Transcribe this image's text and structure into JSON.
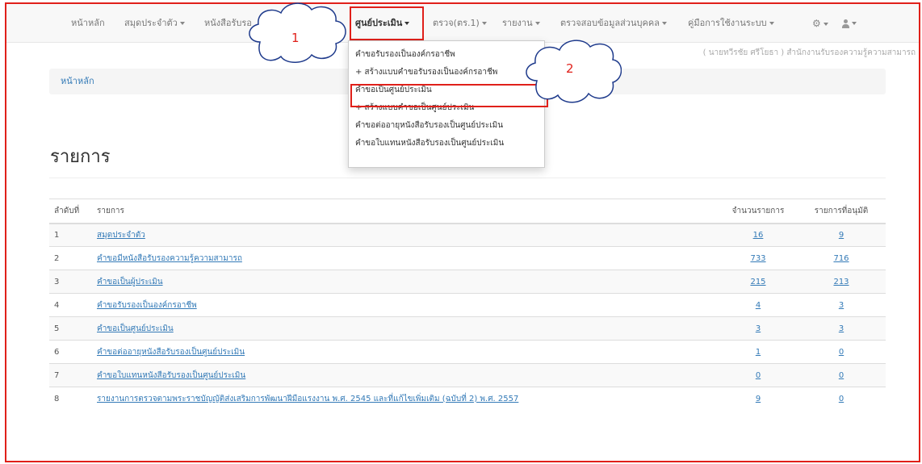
{
  "navbar": {
    "items": [
      {
        "label": "หน้าหลัก"
      },
      {
        "label": "สมุดประจำตัว"
      },
      {
        "label": "หนังสือรับรอ"
      },
      {
        "label": "ศูนย์ประเมิน"
      },
      {
        "label": "ตรวจ(ตร.1)"
      },
      {
        "label": "รายงาน"
      },
      {
        "label": "ตรวจสอบข้อมูลส่วนบุคคล"
      },
      {
        "label": "คู่มือการใช้งานระบบ"
      }
    ],
    "settings_icon": "gear-icon",
    "user_icon": "user-icon"
  },
  "user_info": "( นายทวีรชัย ศรีโยธา ) สำนักงานรับรองความรู้ความสามารถ",
  "breadcrumb": {
    "home": "หน้าหลัก"
  },
  "dropdown": {
    "items": [
      "คำขอรับรองเป็นองค์กรอาชีพ",
      "+ สร้างแบบคำขอรับรองเป็นองค์กรอาชีพ",
      "คำขอเป็นศูนย์ประเมิน",
      "+ สร้างแบบคำขอเป็นศูนย์ประเมิน",
      "คำขอต่ออายุหนังสือรับรองเป็นศูนย์ประเมิน",
      "คำขอใบแทนหนังสือรับรองเป็นศูนย์ประเมิน"
    ]
  },
  "annotations": {
    "step1": "1",
    "step2": "2",
    "color": "#e0201a"
  },
  "page_title": "รายการ",
  "table": {
    "headers": {
      "num": "ลำดับที่",
      "item": "รายการ",
      "count": "จำนวนรายการ",
      "approved": "รายการที่อนุมัติ"
    },
    "rows": [
      {
        "num": "1",
        "item": "สมุดประจำตัว",
        "count": "16",
        "approved": "9"
      },
      {
        "num": "2",
        "item": "คำขอมีหนังสือรับรองความรู้ความสามารถ",
        "count": "733",
        "approved": "716"
      },
      {
        "num": "3",
        "item": "คำขอเป็นผู้ประเมิน",
        "count": "215",
        "approved": "213"
      },
      {
        "num": "4",
        "item": "คำขอรับรองเป็นองค์กรอาชีพ",
        "count": "4",
        "approved": "3"
      },
      {
        "num": "5",
        "item": "คำขอเป็นศูนย์ประเมิน",
        "count": "3",
        "approved": "3"
      },
      {
        "num": "6",
        "item": "คำขอต่ออายุหนังสือรับรองเป็นศูนย์ประเมิน",
        "count": "1",
        "approved": "0"
      },
      {
        "num": "7",
        "item": "คำขอใบแทนหนังสือรับรองเป็นศูนย์ประเมิน",
        "count": "0",
        "approved": "0"
      },
      {
        "num": "8",
        "item": "รายงานการตรวจตามพระราชบัญญัติส่งเสริมการพัฒนาฝีมือแรงงาน พ.ศ. 2545 และที่แก้ไขเพิ่มเติม (ฉบับที่ 2) พ.ศ. 2557",
        "count": "9",
        "approved": "0"
      }
    ]
  }
}
